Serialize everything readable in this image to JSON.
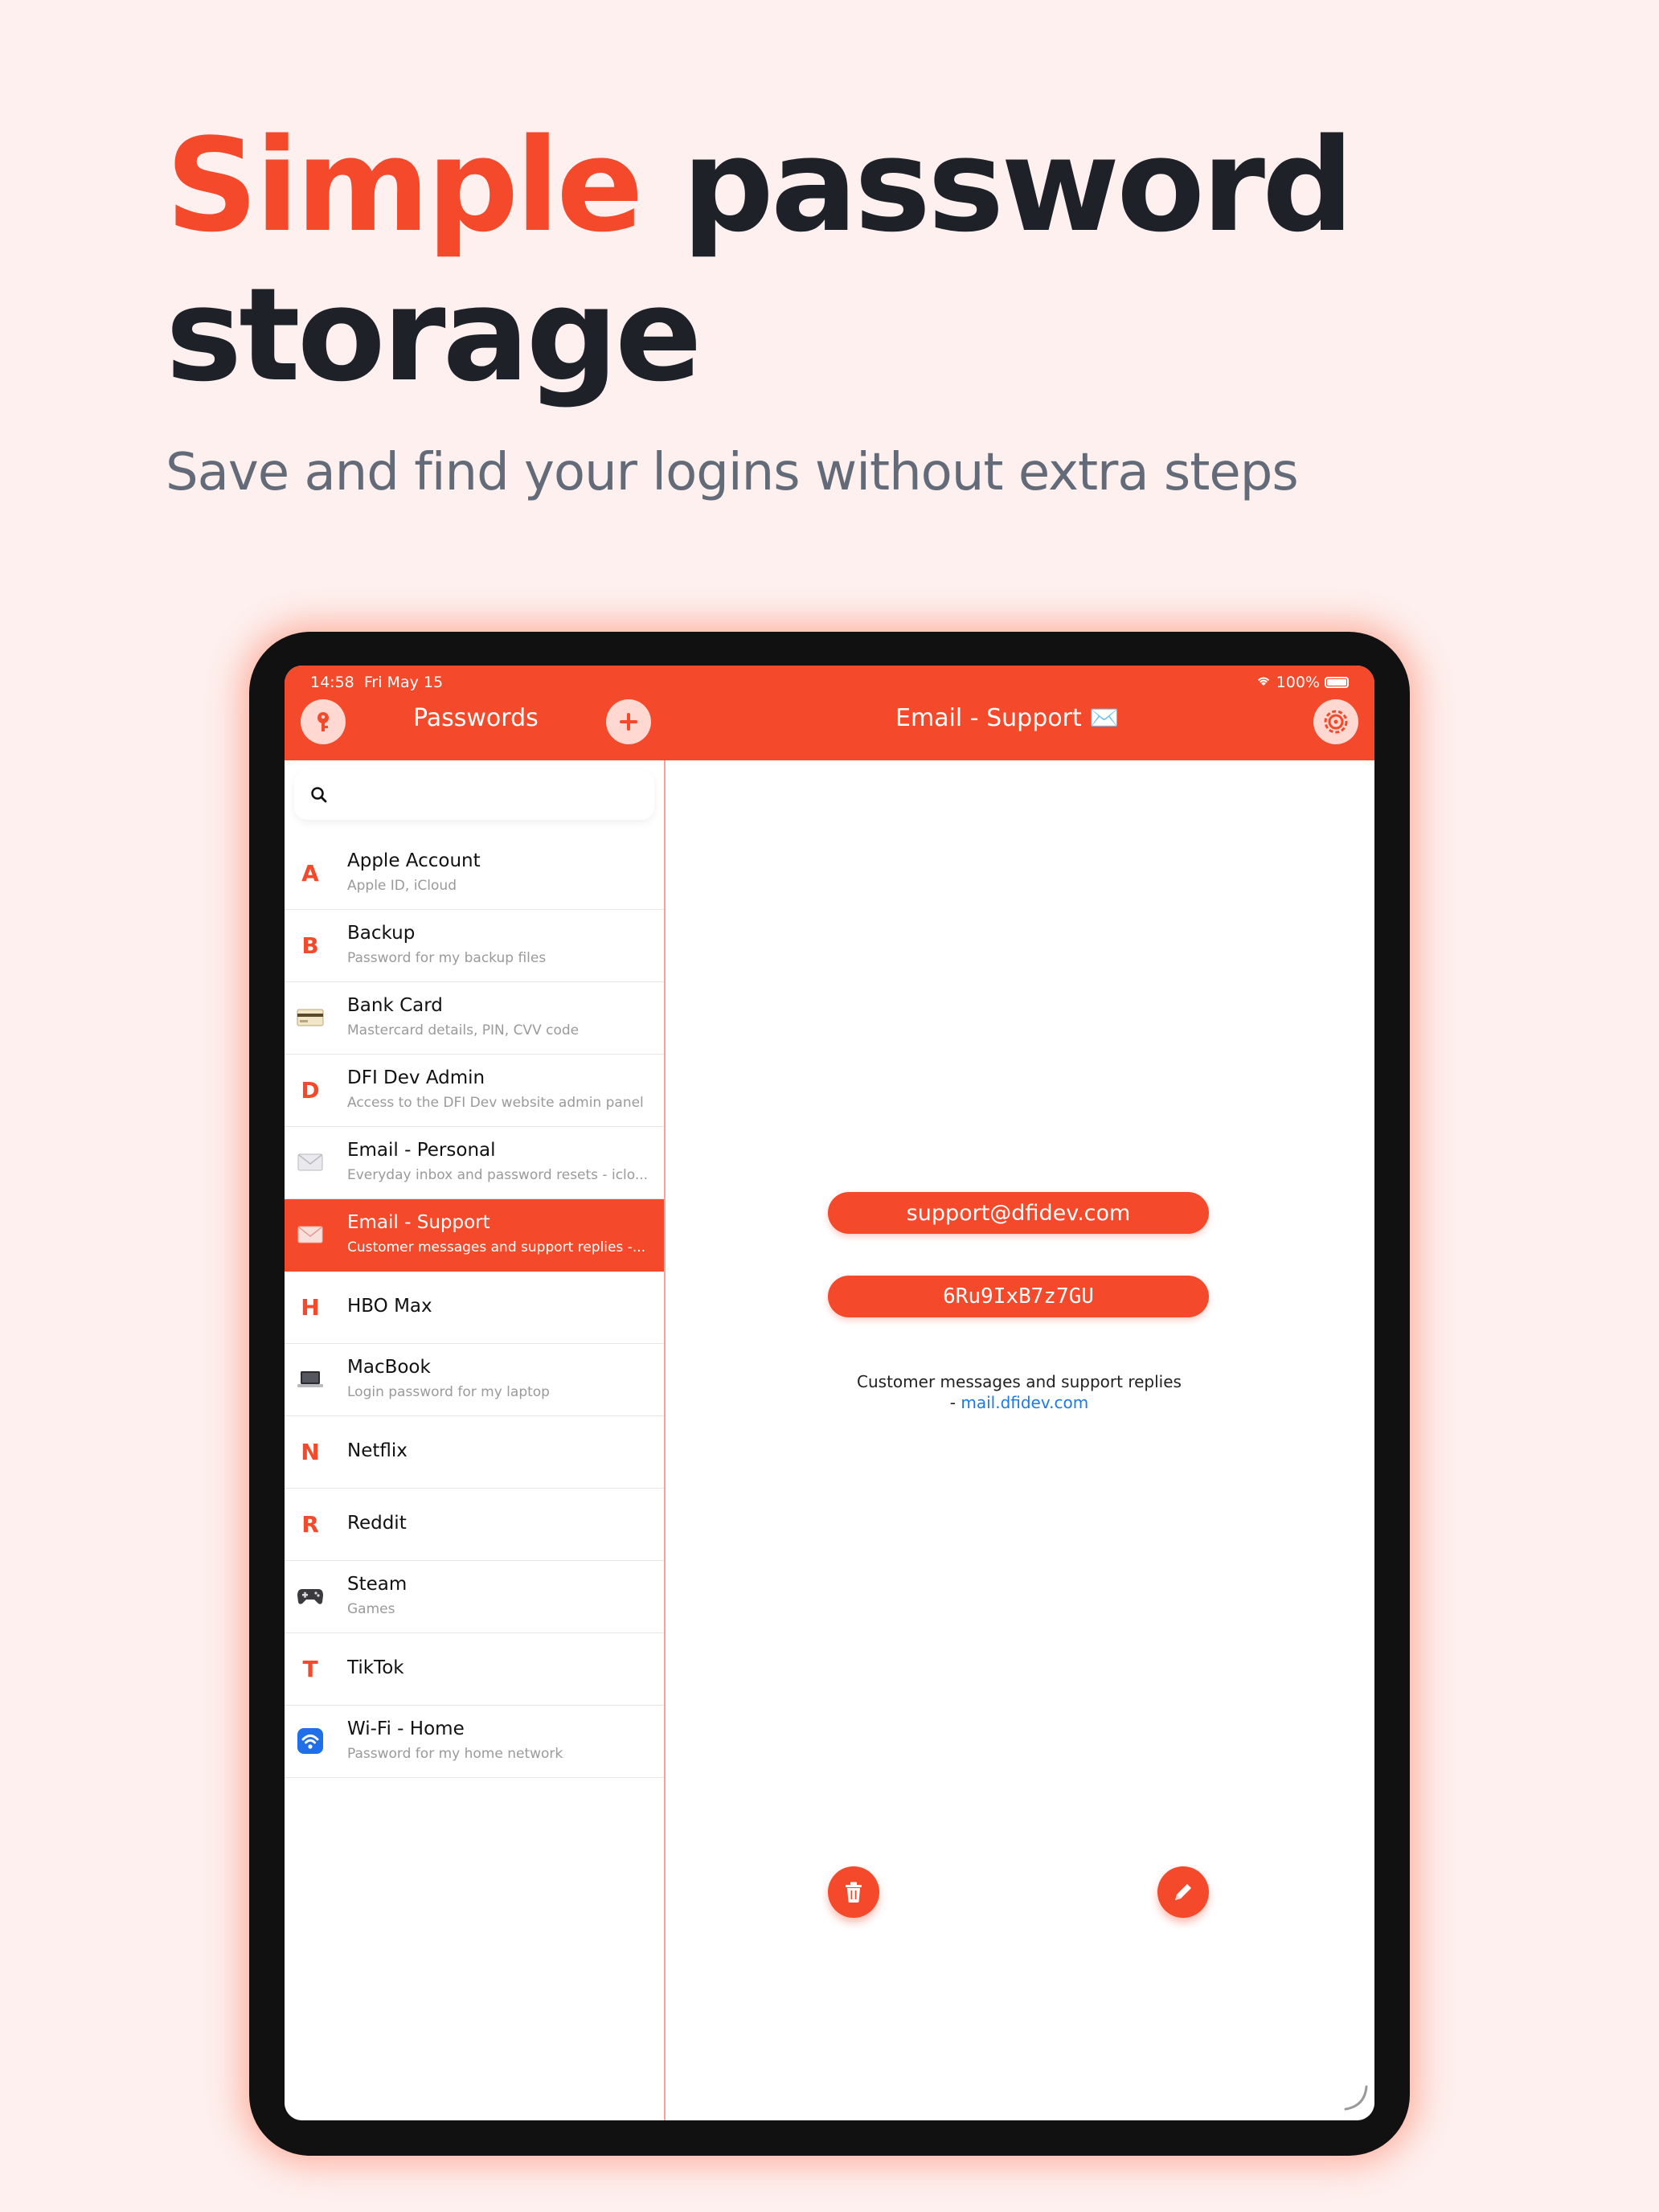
{
  "headline": {
    "accent": "Simple",
    "rest_line1": " password",
    "line2": "storage"
  },
  "subtitle": "Save and find your logins without extra steps",
  "status_bar": {
    "time": "14:58",
    "date": "Fri May 15",
    "battery": "100%"
  },
  "nav": {
    "left_title": "Passwords",
    "right_title": "Email - Support ✉️"
  },
  "search": {
    "placeholder": ""
  },
  "list": [
    {
      "icon": "A",
      "title": "Apple Account",
      "subtitle": "Apple ID, iCloud"
    },
    {
      "icon": "B",
      "title": "Backup",
      "subtitle": "Password for my backup files"
    },
    {
      "icon": "credit-card-icon",
      "title": "Bank Card",
      "subtitle": "Mastercard details, PIN, CVV code"
    },
    {
      "icon": "D",
      "title": "DFI Dev Admin",
      "subtitle": "Access to the DFI Dev website admin panel"
    },
    {
      "icon": "envelope-icon",
      "title": "Email - Personal",
      "subtitle": "Everyday inbox and password resets - iclo..."
    },
    {
      "icon": "envelope-icon",
      "title": "Email - Support",
      "subtitle": "Customer messages and support replies -...",
      "selected": true
    },
    {
      "icon": "H",
      "title": "HBO Max",
      "subtitle": ""
    },
    {
      "icon": "laptop-icon",
      "title": "MacBook",
      "subtitle": "Login password for my laptop"
    },
    {
      "icon": "N",
      "title": "Netflix",
      "subtitle": ""
    },
    {
      "icon": "R",
      "title": "Reddit",
      "subtitle": ""
    },
    {
      "icon": "gamepad-icon",
      "title": "Steam",
      "subtitle": "Games"
    },
    {
      "icon": "T",
      "title": "TikTok",
      "subtitle": ""
    },
    {
      "icon": "wifi-icon",
      "title": "Wi-Fi - Home",
      "subtitle": "Password for my home network"
    }
  ],
  "detail": {
    "login": "support@dfidev.com",
    "password": "6Ru9IxB7z7GU",
    "note_line1": "Customer messages and support replies",
    "note_prefix": "- ",
    "note_link": "mail.dfidev.com"
  },
  "colors": {
    "accent": "#f4492a",
    "background": "#fdf0ee",
    "link": "#1a7be8"
  }
}
